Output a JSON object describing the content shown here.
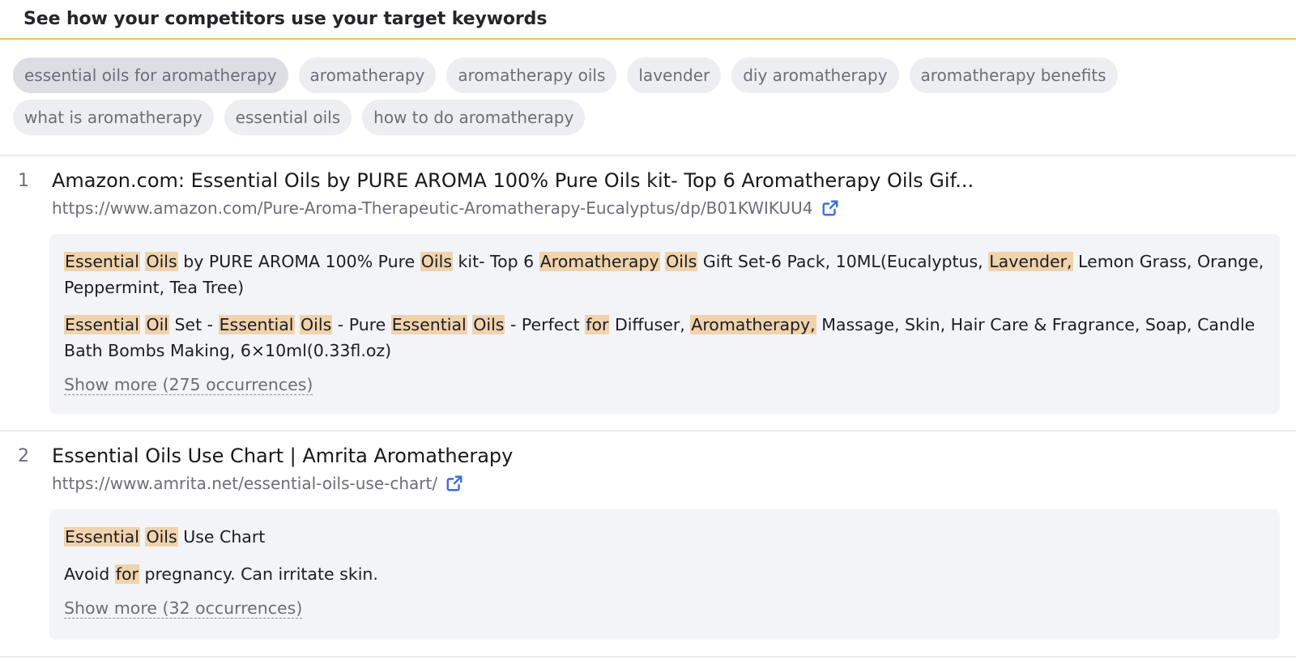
{
  "header": {
    "title": "See how your competitors use your target keywords"
  },
  "keywords": {
    "row1": [
      {
        "label": "essential oils for aromatherapy",
        "active": true
      },
      {
        "label": "aromatherapy"
      },
      {
        "label": "aromatherapy oils"
      },
      {
        "label": "lavender"
      },
      {
        "label": "diy aromatherapy"
      },
      {
        "label": "aromatherapy benefits"
      }
    ],
    "row2": [
      {
        "label": "what is aromatherapy"
      },
      {
        "label": "essential oils"
      },
      {
        "label": "how to do aromatherapy"
      }
    ]
  },
  "results": [
    {
      "rank": "1",
      "title": "Amazon.com: Essential Oils by PURE AROMA 100% Pure Oils kit- Top 6 Aromatherapy Oils Gif...",
      "url": "https://www.amazon.com/Pure-Aroma-Therapeutic-Aromatherapy-Eucalyptus/dp/B01KWIKUU4",
      "snippets": [
        [
          {
            "t": "Essential",
            "h": true
          },
          {
            "t": " "
          },
          {
            "t": "Oils",
            "h": true
          },
          {
            "t": " by PURE AROMA 100% Pure "
          },
          {
            "t": "Oils",
            "h": true
          },
          {
            "t": " kit- Top 6 "
          },
          {
            "t": "Aromatherapy",
            "h": true
          },
          {
            "t": " "
          },
          {
            "t": "Oils",
            "h": true
          },
          {
            "t": " Gift Set-6 Pack, 10ML(Eucalyptus, "
          },
          {
            "t": "Lavender,",
            "h": true
          },
          {
            "t": " Lemon Grass, Orange, Peppermint, Tea Tree)"
          }
        ],
        [
          {
            "t": "Essential",
            "h": true
          },
          {
            "t": " "
          },
          {
            "t": "Oil",
            "h": true
          },
          {
            "t": " Set - "
          },
          {
            "t": "Essential",
            "h": true
          },
          {
            "t": " "
          },
          {
            "t": "Oils",
            "h": true
          },
          {
            "t": " - Pure "
          },
          {
            "t": "Essential",
            "h": true
          },
          {
            "t": " "
          },
          {
            "t": "Oils",
            "h": true
          },
          {
            "t": " - Perfect "
          },
          {
            "t": "for",
            "h": true
          },
          {
            "t": " Diffuser, "
          },
          {
            "t": "Aromatherapy,",
            "h": true
          },
          {
            "t": " Massage, Skin, Hair Care & Fragrance, Soap, Candle Bath Bombs Making, 6×10ml(0.33fl.oz)"
          }
        ]
      ],
      "show_more": "Show more (275 occurrences)"
    },
    {
      "rank": "2",
      "title": "Essential Oils Use Chart | Amrita Aromatherapy",
      "url": "https://www.amrita.net/essential-oils-use-chart/",
      "snippets": [
        [
          {
            "t": "Essential",
            "h": true
          },
          {
            "t": " "
          },
          {
            "t": "Oils",
            "h": true
          },
          {
            "t": " Use Chart"
          }
        ],
        [
          {
            "t": "Avoid "
          },
          {
            "t": "for",
            "h": true
          },
          {
            "t": " pregnancy. Can irritate skin."
          }
        ]
      ],
      "show_more": "Show more (32 occurrences)"
    }
  ],
  "icons": {
    "external": "external-link-icon",
    "accent": "#3a6fd8"
  },
  "colors": {
    "highlight": "#f0d3ad",
    "header_border": "#f0c25e"
  }
}
